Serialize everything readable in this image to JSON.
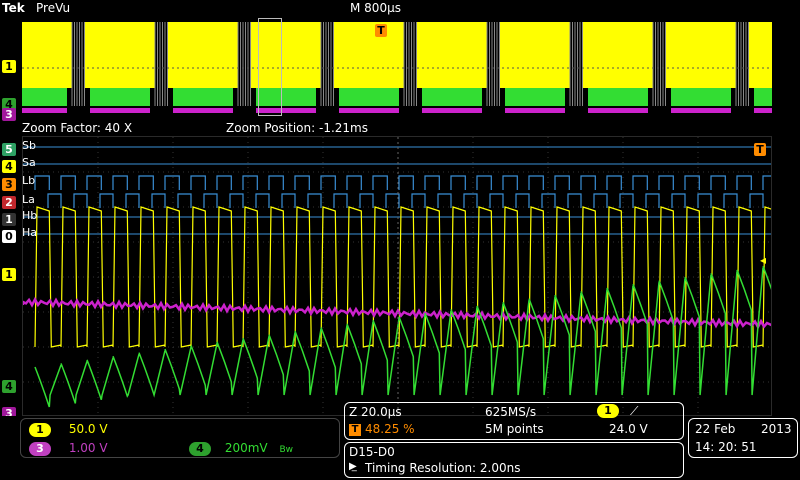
{
  "header": {
    "brand": "Tek",
    "mode": "PreVu",
    "timebase": "M 800µs"
  },
  "zoom": {
    "factor": "Zoom Factor: 40 X",
    "position": "Zoom Position: -1.21ms"
  },
  "digital_channels": [
    {
      "label": "Sb",
      "marker": "5"
    },
    {
      "label": "Sa",
      "marker": "4"
    },
    {
      "label": "Lb",
      "marker": "3"
    },
    {
      "label": "La",
      "marker": "2"
    },
    {
      "label": "Hb",
      "marker": "1"
    },
    {
      "label": "Ha",
      "marker": "0"
    }
  ],
  "analog_markers": {
    "ch1": "1",
    "ch3": "3",
    "ch4": "4",
    "trigger": "T"
  },
  "channels": [
    {
      "num": "1",
      "value": "50.0 V",
      "color": "#ffff00"
    },
    {
      "num": "3",
      "value": "1.00 V",
      "color": "#c040c0"
    },
    {
      "num": "4",
      "value": "200mV",
      "color": "#33cc33",
      "suffix": "Bw"
    }
  ],
  "acquisition": {
    "zoom_scale": "Z 20.0µs",
    "sample_rate": "625MS/s",
    "trigger_pos": "48.25 %",
    "record_length": "5M points",
    "trigger_channel": "1",
    "trigger_slope": "⟋",
    "trigger_level": "24.0 V"
  },
  "digital_group": {
    "name": "D15-D0",
    "resolution": "Timing Resolution: 2.00ns"
  },
  "datetime": {
    "date": "22 Feb",
    "year": "2013",
    "time": "14: 20: 51"
  },
  "colors": {
    "ch1": "#ffff00",
    "ch3": "#cc22cc",
    "ch4": "#33dd33",
    "digital": "#3a8fd6",
    "trigger": "#ff8c00"
  }
}
